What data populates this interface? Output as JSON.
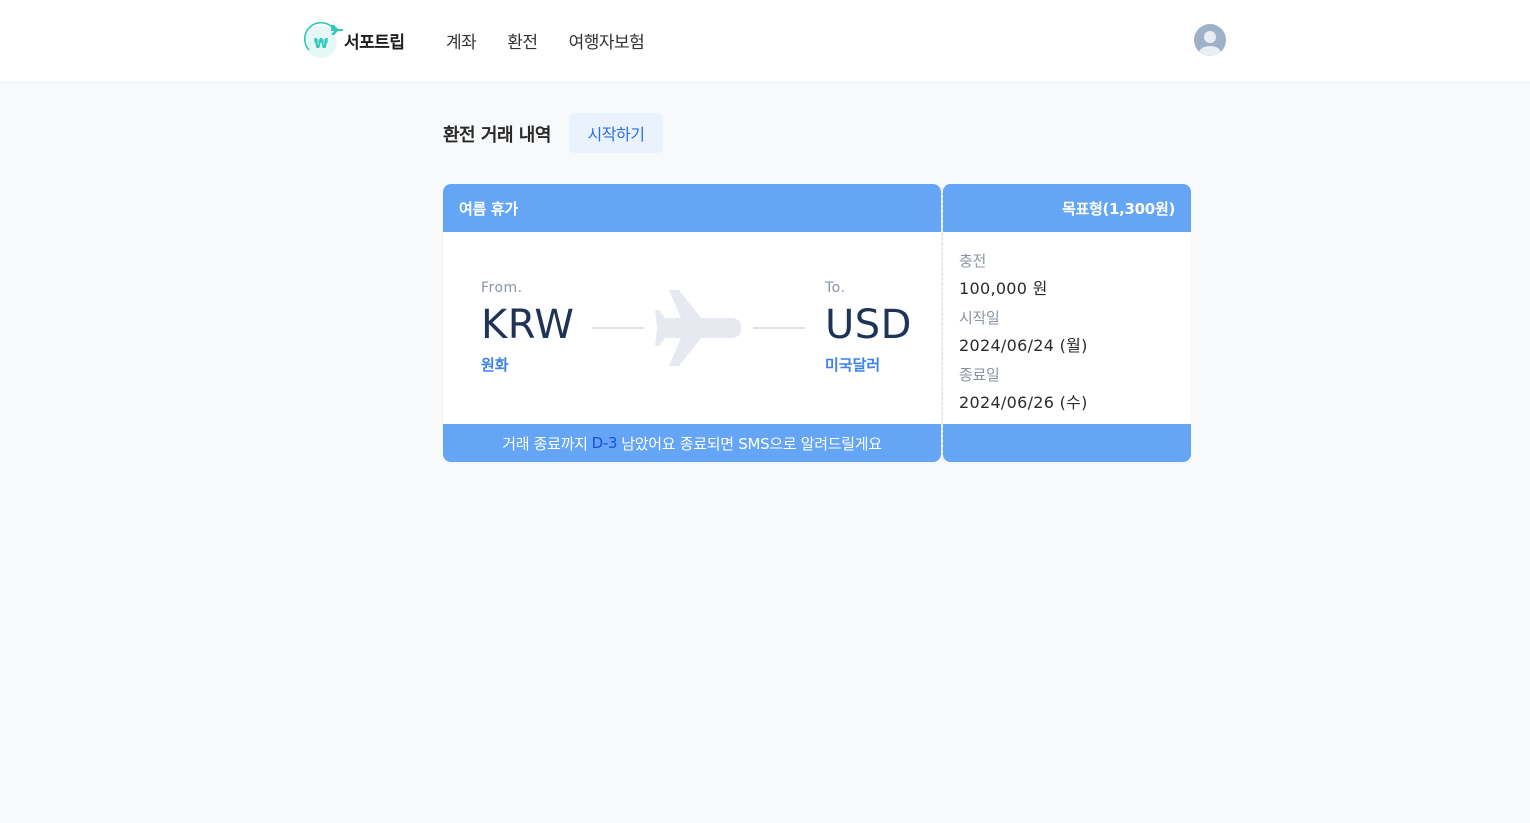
{
  "header": {
    "logo_text": "서포트립",
    "nav": [
      "계좌",
      "환전",
      "여행자보험"
    ],
    "brand_color": "#2ec9b7"
  },
  "page": {
    "title": "환전 거래 내역",
    "start_button": "시작하기"
  },
  "card": {
    "name": "여름 휴가",
    "type": "목표형(1,300원)",
    "from": {
      "label": "From.",
      "code": "KRW",
      "name": "원화"
    },
    "to": {
      "label": "To.",
      "code": "USD",
      "name": "미국달러"
    },
    "footer_before": "거래 종료까지",
    "footer_dday": "D-3",
    "footer_after": "남았어요 종료되면 SMS으로 알려드릴게요",
    "charge_label": "충전",
    "charge_value": "100,000 원",
    "start_label": "시작일",
    "start_value": "2024/06/24 (월)",
    "end_label": "종료일",
    "end_value": "2024/06/26 (수)",
    "accent_color": "#64a5f6"
  }
}
